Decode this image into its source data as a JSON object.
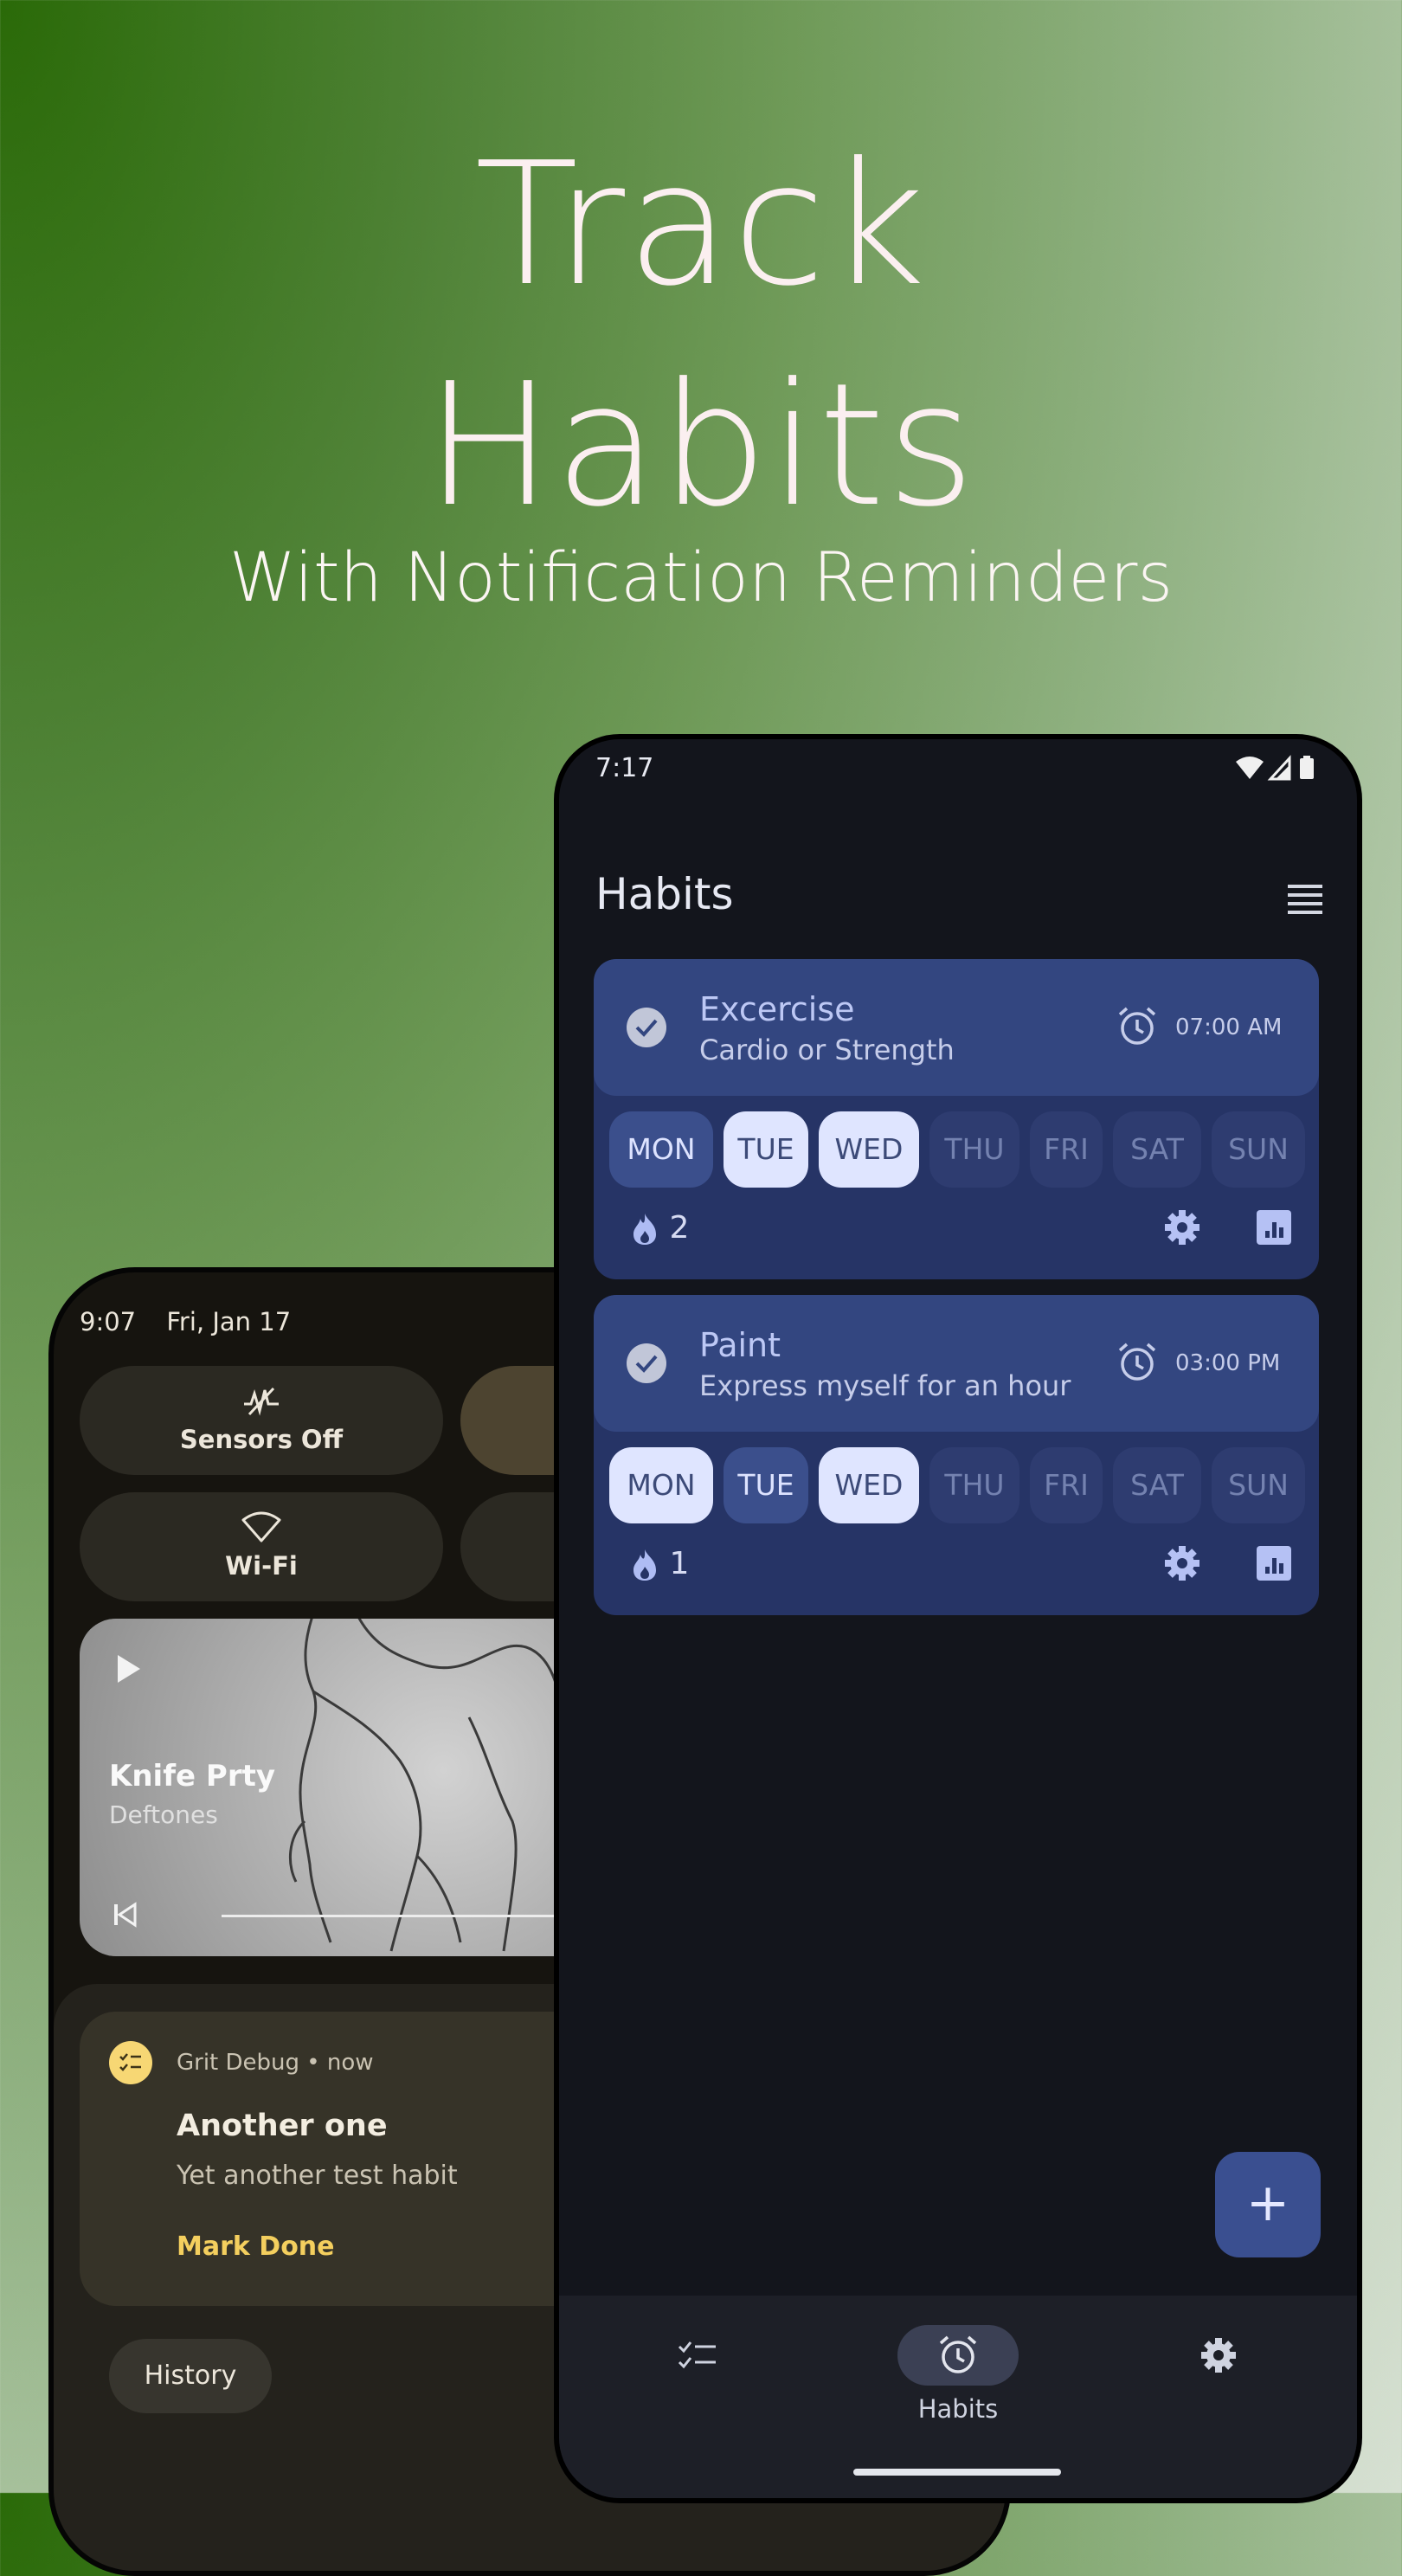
{
  "hero": {
    "line1": "Track",
    "line2": "Habits",
    "subtitle": "With Notification Reminders"
  },
  "shade": {
    "time": "9:07",
    "date": "Fri, Jan 17",
    "tiles": [
      {
        "label": "Sensors Off",
        "icon": "sensors-off-icon"
      },
      {
        "label": "Wi-Fi",
        "icon": "wifi-icon"
      }
    ],
    "media": {
      "song": "Knife Prty",
      "artist": "Deftones"
    },
    "notification": {
      "app": "Grit Debug • now",
      "title": "Another one",
      "text": "Yet another test habit",
      "action": "Mark Done"
    },
    "history_label": "History"
  },
  "app": {
    "status_time": "7:17",
    "title": "Habits",
    "colors": {
      "background": "#13151c",
      "card": "#263466",
      "card_header": "#334680",
      "selected_day": "#dfe5ff"
    },
    "habits": [
      {
        "name": "Excercise",
        "description": "Cardio or Strength",
        "time": "07:00 AM",
        "streak": "2",
        "days": [
          {
            "label": "MON",
            "state": "on"
          },
          {
            "label": "TUE",
            "state": "selected"
          },
          {
            "label": "WED",
            "state": "selected"
          },
          {
            "label": "THU",
            "state": "off"
          },
          {
            "label": "FRI",
            "state": "off"
          },
          {
            "label": "SAT",
            "state": "off"
          },
          {
            "label": "SUN",
            "state": "off"
          }
        ]
      },
      {
        "name": "Paint",
        "description": "Express myself for an hour",
        "time": "03:00 PM",
        "streak": "1",
        "days": [
          {
            "label": "MON",
            "state": "selected"
          },
          {
            "label": "TUE",
            "state": "on"
          },
          {
            "label": "WED",
            "state": "selected"
          },
          {
            "label": "THU",
            "state": "off"
          },
          {
            "label": "FRI",
            "state": "off"
          },
          {
            "label": "SAT",
            "state": "off"
          },
          {
            "label": "SUN",
            "state": "off"
          }
        ]
      }
    ],
    "fab_label": "+",
    "nav": [
      {
        "label": "",
        "icon": "checklist-icon"
      },
      {
        "label": "Habits",
        "icon": "alarm-icon",
        "active": true
      },
      {
        "label": "",
        "icon": "settings-icon"
      }
    ]
  }
}
